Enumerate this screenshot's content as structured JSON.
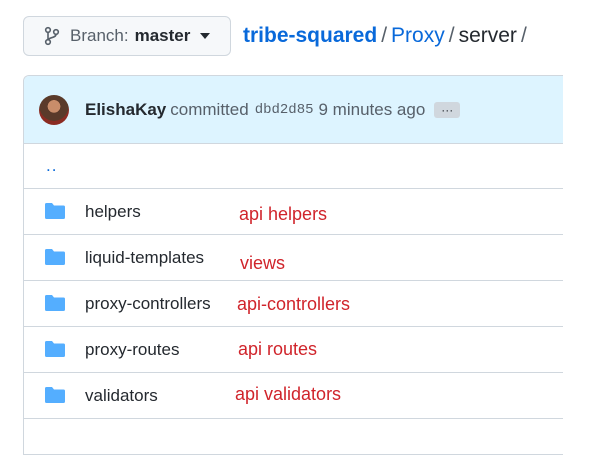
{
  "branch": {
    "prefix": "Branch:",
    "name": "master"
  },
  "breadcrumb": {
    "root": "tribe-squared",
    "segment": "Proxy",
    "current": "server",
    "separator": "/"
  },
  "commit": {
    "author": "ElishaKay",
    "verb": "committed",
    "sha": "dbd2d85",
    "time": "9 minutes ago",
    "ellipsis": "···"
  },
  "parent_dir": "..",
  "files": [
    {
      "name": "helpers",
      "type": "folder"
    },
    {
      "name": "liquid-templates",
      "type": "folder"
    },
    {
      "name": "proxy-controllers",
      "type": "folder"
    },
    {
      "name": "proxy-routes",
      "type": "folder"
    },
    {
      "name": "validators",
      "type": "folder"
    }
  ],
  "annotations": [
    "api helpers",
    "views",
    "api-controllers",
    "api routes",
    "api validators"
  ],
  "colors": {
    "link": "#0969da",
    "folder": "#54aeff",
    "annotation": "#d0242b",
    "commit_bg": "#ddf4ff"
  }
}
